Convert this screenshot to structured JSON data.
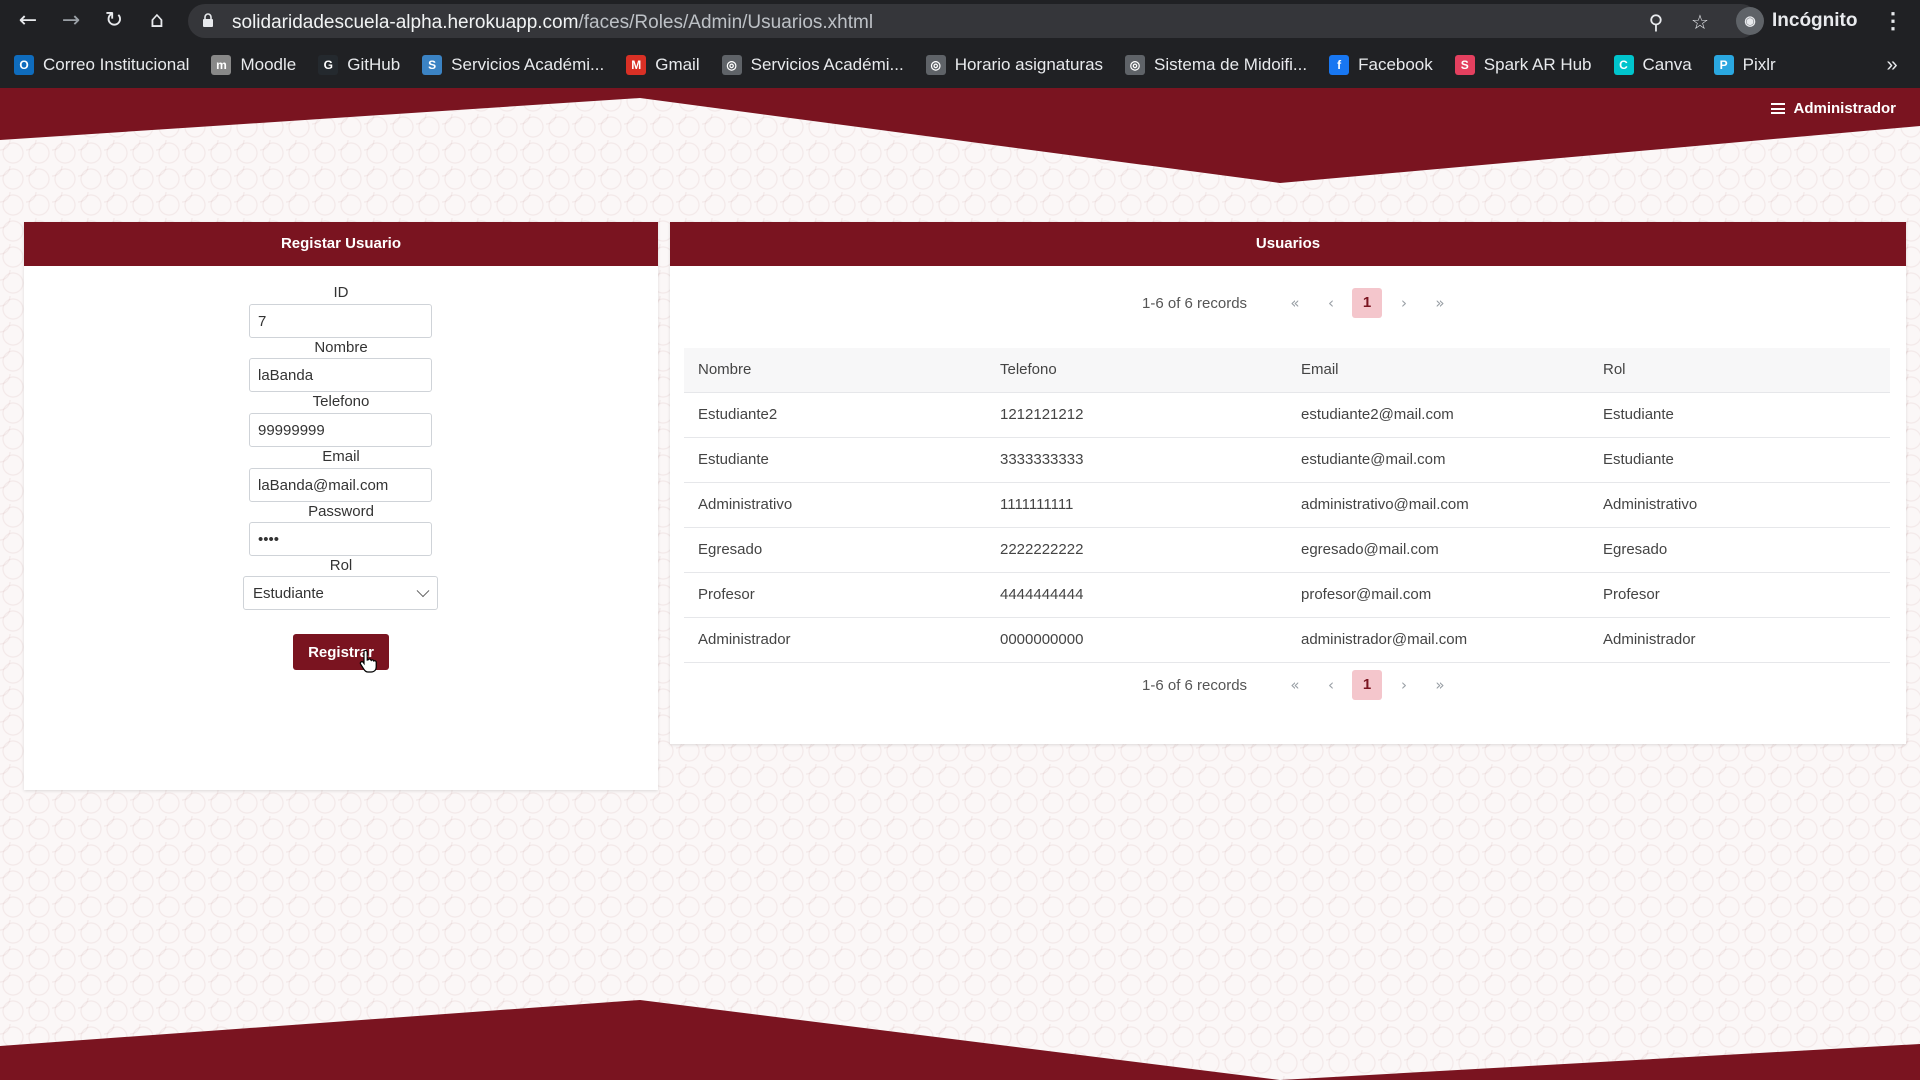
{
  "browser": {
    "url_host": "solidaridadescuela-alpha.herokuapp.com",
    "url_path": "/faces/Roles/Admin/Usuarios.xhtml",
    "profile_label": "Incógnito",
    "bookmarks": [
      {
        "label": "Correo Institucional",
        "icon": "outlook-icon",
        "color": "#0f6cbd"
      },
      {
        "label": "Moodle",
        "icon": "moodle-icon",
        "color": "#888888"
      },
      {
        "label": "GitHub",
        "icon": "github-icon",
        "color": "#24292e"
      },
      {
        "label": "Servicios Académi...",
        "icon": "sia-icon",
        "color": "#3b83c4"
      },
      {
        "label": "Gmail",
        "icon": "gmail-icon",
        "color": "#d93025"
      },
      {
        "label": "Servicios Académi...",
        "icon": "globe-icon",
        "color": "#5f6368"
      },
      {
        "label": "Horario asignaturas",
        "icon": "globe-icon",
        "color": "#5f6368"
      },
      {
        "label": "Sistema de Midoifi...",
        "icon": "globe-icon",
        "color": "#5f6368"
      },
      {
        "label": "Facebook",
        "icon": "facebook-icon",
        "color": "#1877f2"
      },
      {
        "label": "Spark AR Hub",
        "icon": "spark-ar-icon",
        "color": "#e4405f"
      },
      {
        "label": "Canva",
        "icon": "canva-icon",
        "color": "#00c4cc"
      },
      {
        "label": "Pixlr",
        "icon": "pixlr-icon",
        "color": "#2aa7e0"
      }
    ]
  },
  "header": {
    "user_menu_label": "Administrador"
  },
  "form": {
    "title": "Registar Usuario",
    "fields": {
      "id": {
        "label": "ID",
        "value": "7"
      },
      "nombre": {
        "label": "Nombre",
        "value": "laBanda"
      },
      "telefono": {
        "label": "Telefono",
        "value": "99999999"
      },
      "email": {
        "label": "Email",
        "value": "laBanda@mail.com"
      },
      "password": {
        "label": "Password",
        "value": "••••"
      },
      "rol": {
        "label": "Rol",
        "value": "Estudiante"
      }
    },
    "submit_label": "Registrar"
  },
  "users_table": {
    "title": "Usuarios",
    "paginator": {
      "info": "1-6 of 6 records",
      "current_page": "1"
    },
    "columns": [
      "Nombre",
      "Telefono",
      "Email",
      "Rol"
    ],
    "rows": [
      [
        "Estudiante2",
        "1212121212",
        "estudiante2@mail.com",
        "Estudiante"
      ],
      [
        "Estudiante",
        "3333333333",
        "estudiante@mail.com",
        "Estudiante"
      ],
      [
        "Administrativo",
        "1111111111",
        "administrativo@mail.com",
        "Administrativo"
      ],
      [
        "Egresado",
        "2222222222",
        "egresado@mail.com",
        "Egresado"
      ],
      [
        "Profesor",
        "4444444444",
        "profesor@mail.com",
        "Profesor"
      ],
      [
        "Administrador",
        "0000000000",
        "administrador@mail.com",
        "Administrador"
      ]
    ]
  },
  "colors": {
    "brand": "#7a1420",
    "page_current": "#f4c6cc"
  }
}
